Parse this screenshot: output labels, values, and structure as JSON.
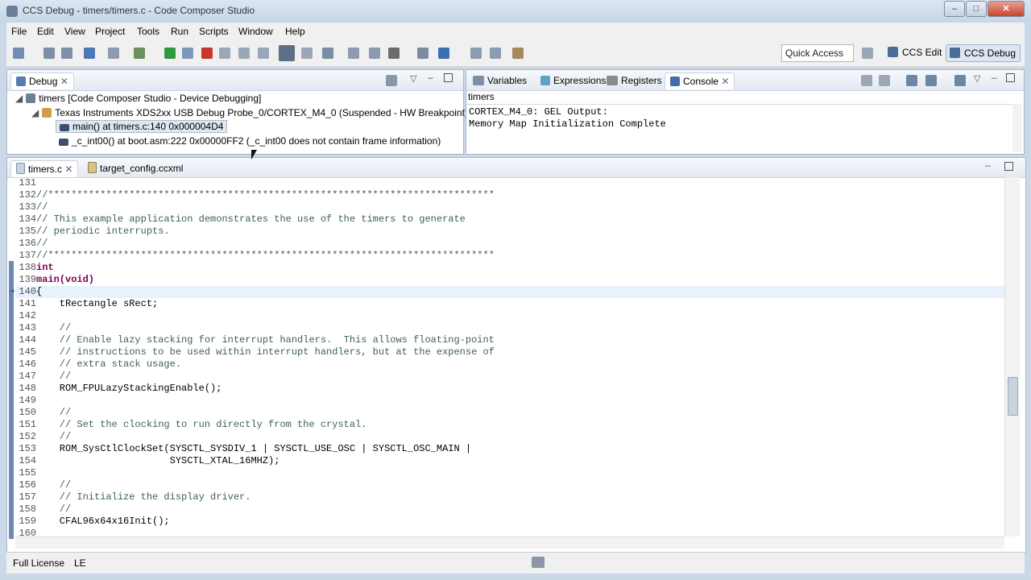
{
  "window": {
    "title": "CCS Debug - timers/timers.c - Code Composer Studio"
  },
  "menu": [
    "File",
    "Edit",
    "View",
    "Project",
    "Tools",
    "Run",
    "Scripts",
    "Window",
    "Help"
  ],
  "toolbar": {
    "quick_access_placeholder": "Quick Access",
    "persp_edit": "CCS Edit",
    "persp_debug": "CCS Debug"
  },
  "debug_view": {
    "tab": "Debug",
    "session": "timers [Code Composer Studio - Device Debugging]",
    "target": "Texas Instruments XDS2xx USB Debug Probe_0/CORTEX_M4_0 (Suspended - HW Breakpoint)",
    "frames": [
      "main() at timers.c:140 0x000004D4",
      "_c_int00() at boot.asm:222 0x00000FF2  (_c_int00 does not contain frame information)"
    ]
  },
  "console_view": {
    "tabs": [
      "Variables",
      "Expressions",
      "Registers",
      "Console"
    ],
    "project": "timers",
    "lines": [
      "CORTEX_M4_0: GEL Output:",
      "Memory Map Initialization Complete"
    ]
  },
  "editor": {
    "tabs": [
      "timers.c",
      "target_config.ccxml"
    ],
    "current_line": 140,
    "lines": [
      {
        "n": "131",
        "t": ""
      },
      {
        "n": "132",
        "t": "//*****************************************************************************"
      },
      {
        "n": "133",
        "t": "//"
      },
      {
        "n": "134",
        "t": "// This example application demonstrates the use of the timers to generate"
      },
      {
        "n": "135",
        "t": "// periodic interrupts."
      },
      {
        "n": "136",
        "t": "//"
      },
      {
        "n": "137",
        "t": "//*****************************************************************************"
      },
      {
        "n": "138",
        "t": "int"
      },
      {
        "n": "139",
        "t": "main(void)"
      },
      {
        "n": "140",
        "t": "{"
      },
      {
        "n": "141",
        "t": "    tRectangle sRect;"
      },
      {
        "n": "142",
        "t": ""
      },
      {
        "n": "143",
        "t": "    //"
      },
      {
        "n": "144",
        "t": "    // Enable lazy stacking for interrupt handlers.  This allows floating-point"
      },
      {
        "n": "145",
        "t": "    // instructions to be used within interrupt handlers, but at the expense of"
      },
      {
        "n": "146",
        "t": "    // extra stack usage."
      },
      {
        "n": "147",
        "t": "    //"
      },
      {
        "n": "148",
        "t": "    ROM_FPULazyStackingEnable();"
      },
      {
        "n": "149",
        "t": ""
      },
      {
        "n": "150",
        "t": "    //"
      },
      {
        "n": "151",
        "t": "    // Set the clocking to run directly from the crystal."
      },
      {
        "n": "152",
        "t": "    //"
      },
      {
        "n": "153",
        "t": "    ROM_SysCtlClockSet(SYSCTL_SYSDIV_1 | SYSCTL_USE_OSC | SYSCTL_OSC_MAIN |"
      },
      {
        "n": "154",
        "t": "                       SYSCTL_XTAL_16MHZ);"
      },
      {
        "n": "155",
        "t": ""
      },
      {
        "n": "156",
        "t": "    //"
      },
      {
        "n": "157",
        "t": "    // Initialize the display driver."
      },
      {
        "n": "158",
        "t": "    //"
      },
      {
        "n": "159",
        "t": "    CFAL96x64x16Init();"
      },
      {
        "n": "160",
        "t": ""
      }
    ]
  },
  "status": {
    "license": "Full License",
    "mode": "LE"
  },
  "colors": {
    "accent": "#4a6c98",
    "comment": "#3f5f5f",
    "keyword": "#7f0055",
    "current_line": "#e8f2fe"
  }
}
